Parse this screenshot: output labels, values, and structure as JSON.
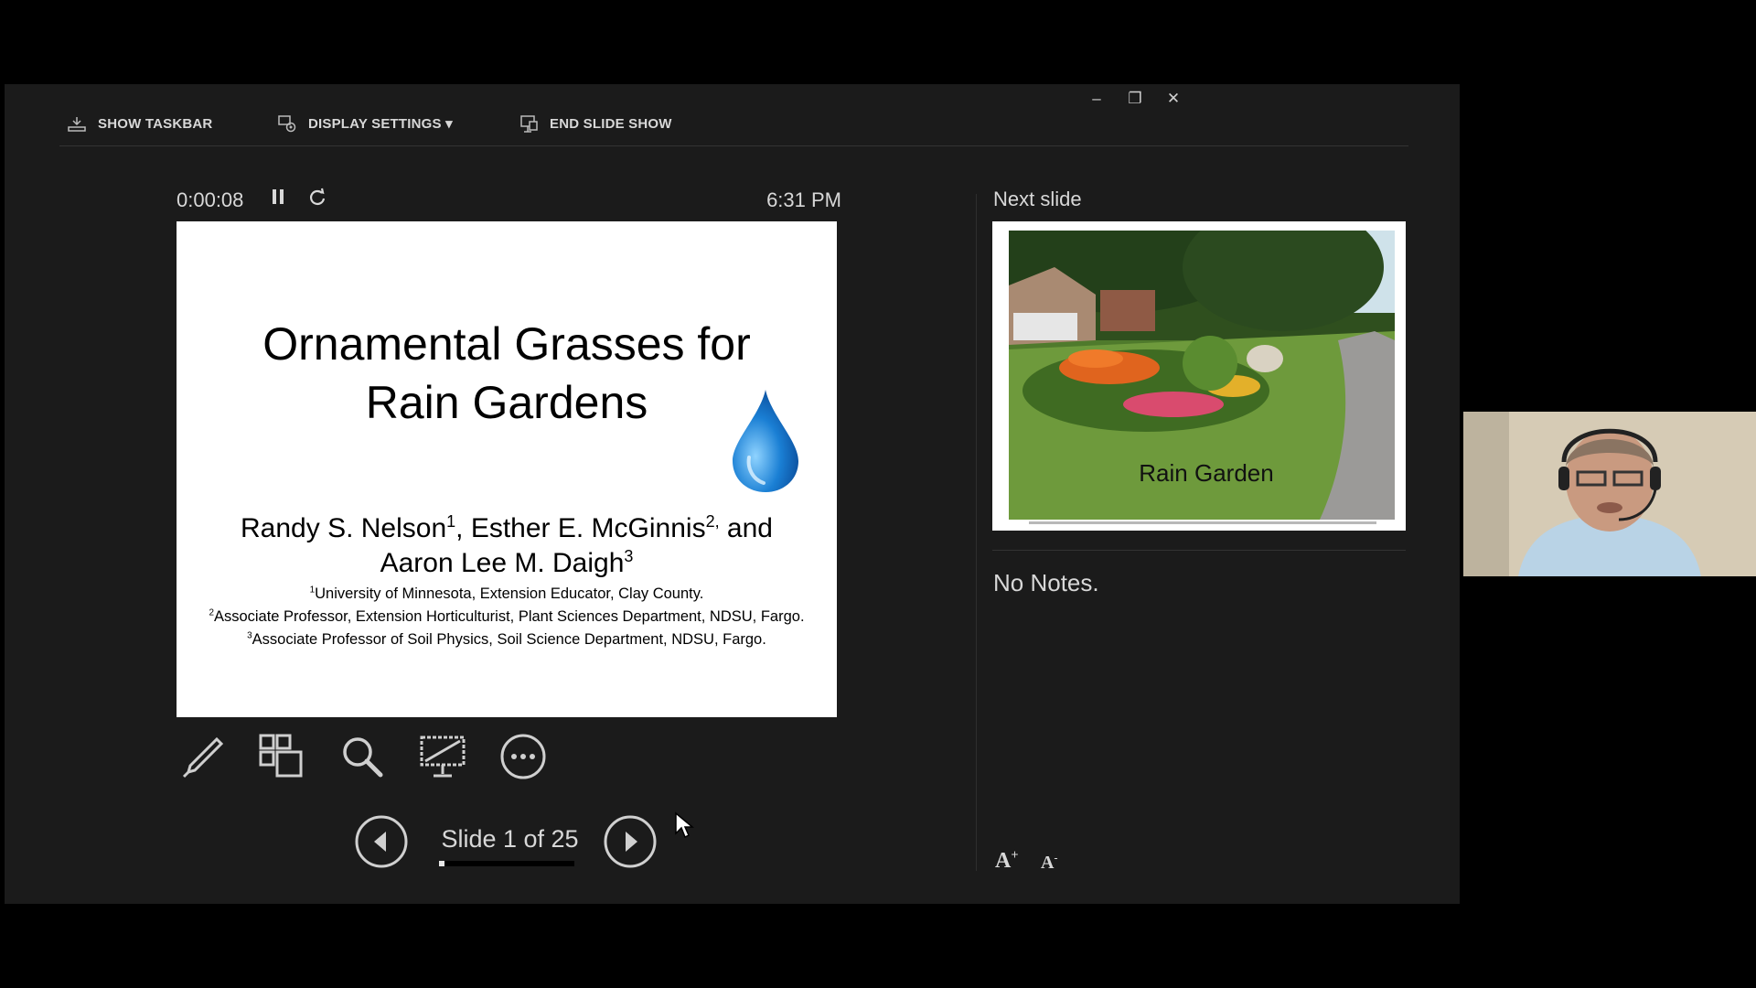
{
  "toolbar": {
    "show_taskbar": "SHOW TASKBAR",
    "display_settings": "DISPLAY SETTINGS ▾",
    "end_slide_show": "END SLIDE SHOW"
  },
  "window_controls": {
    "minimize": "–",
    "restore": "❐",
    "close": "✕"
  },
  "timer": "0:00:08",
  "clock": "6:31 PM",
  "current_slide": {
    "title_line1": "Ornamental Grasses for",
    "title_line2": "Rain Gardens",
    "authors": {
      "a1": "Randy S. Nelson",
      "s1": "1",
      "a2": ", Esther E. McGinnis",
      "s2": "2,",
      "a3": " and",
      "a4": "Aaron Lee M. Daigh",
      "s4": "3"
    },
    "affiliations": [
      {
        "sup": "1",
        "text": "University of Minnesota, Extension Educator, Clay County."
      },
      {
        "sup": "2",
        "text": "Associate Professor, Extension Horticulturist, Plant Sciences Department, NDSU, Fargo."
      },
      {
        "sup": "3",
        "text": "Associate Professor of Soil Physics, Soil Science Department, NDSU, Fargo."
      }
    ]
  },
  "tools": [
    "pen-tool",
    "see-all-slides",
    "zoom",
    "black-screen",
    "more-options"
  ],
  "navigation": {
    "counter": "Slide 1 of 25",
    "current": 1,
    "total": 25,
    "progress": 0.04
  },
  "next_slide": {
    "label": "Next slide",
    "caption": "Rain Garden"
  },
  "notes": "No Notes.",
  "font_controls": {
    "increase": "A",
    "decrease": "A"
  },
  "colors": {
    "background": "#000000",
    "window": "#1b1b1b",
    "text": "#d8d8d8",
    "drop": "#1a7fd4"
  }
}
